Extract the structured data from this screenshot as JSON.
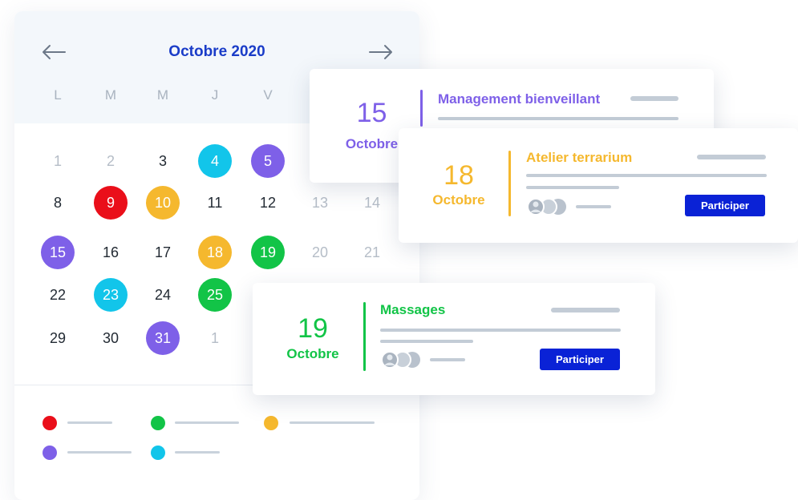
{
  "calendar": {
    "month_title": "Octobre 2020",
    "prev_icon": "arrow-left-icon",
    "next_icon": "arrow-right-icon",
    "weekdays": [
      "L",
      "M",
      "M",
      "J",
      "V"
    ],
    "days": [
      {
        "label": "1",
        "state": "muted"
      },
      {
        "label": "2",
        "state": "muted"
      },
      {
        "label": "3",
        "state": "normal"
      },
      {
        "label": "4",
        "state": "filled",
        "color": "#12c5ea"
      },
      {
        "label": "5",
        "state": "filled",
        "color": "#7e60e8"
      },
      {
        "label": "8",
        "state": "normal"
      },
      {
        "label": "9",
        "state": "filled",
        "color": "#ea0f1a"
      },
      {
        "label": "10",
        "state": "filled",
        "color": "#f5b82e"
      },
      {
        "label": "11",
        "state": "normal"
      },
      {
        "label": "12",
        "state": "normal"
      },
      {
        "label": "13",
        "state": "muted"
      },
      {
        "label": "14",
        "state": "muted"
      },
      {
        "label": "15",
        "state": "filled",
        "color": "#7e60e8"
      },
      {
        "label": "16",
        "state": "normal"
      },
      {
        "label": "17",
        "state": "normal"
      },
      {
        "label": "18",
        "state": "filled",
        "color": "#f5b82e"
      },
      {
        "label": "19",
        "state": "filled",
        "color": "#12c447"
      },
      {
        "label": "20",
        "state": "muted"
      },
      {
        "label": "21",
        "state": "muted"
      },
      {
        "label": "22",
        "state": "normal"
      },
      {
        "label": "23",
        "state": "filled",
        "color": "#12c5ea"
      },
      {
        "label": "24",
        "state": "normal"
      },
      {
        "label": "25",
        "state": "filled",
        "color": "#12c447"
      },
      {
        "label": "29",
        "state": "normal"
      },
      {
        "label": "30",
        "state": "normal"
      },
      {
        "label": "31",
        "state": "filled",
        "color": "#7e60e8"
      },
      {
        "label": "1",
        "state": "muted"
      }
    ],
    "legend_colors": [
      "#ea0f1a",
      "#12c447",
      "#f5b82e",
      "#7e60e8",
      "#12c5ea"
    ]
  },
  "events": [
    {
      "day": "15",
      "month": "Octobre",
      "title": "Management bienveillant",
      "color": "#7e60e8"
    },
    {
      "day": "18",
      "month": "Octobre",
      "title": "Atelier terrarium",
      "color": "#f5b82e",
      "button": "Participer",
      "avatars_icon": "attendees-avatars-icon"
    },
    {
      "day": "19",
      "month": "Octobre",
      "title": "Massages",
      "color": "#12c447",
      "button": "Participer",
      "avatars_icon": "attendees-avatars-icon"
    }
  ],
  "colors": {
    "accent": "#1a3cc8",
    "button": "#0a22d6"
  }
}
